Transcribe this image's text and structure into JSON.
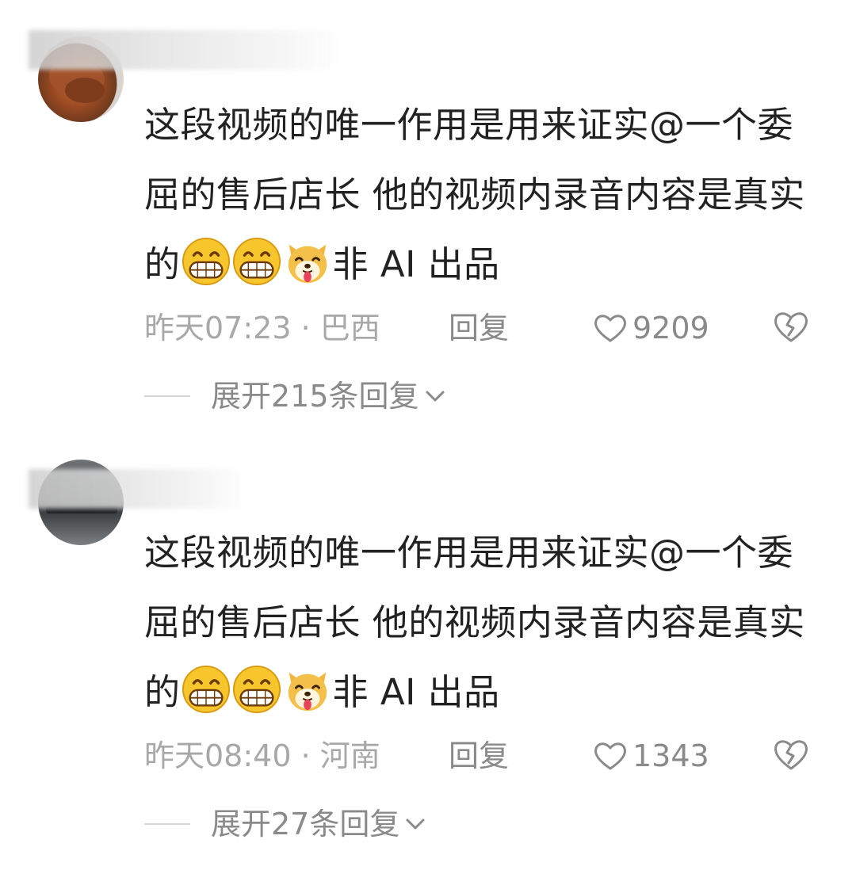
{
  "comments": [
    {
      "text_main": "这段视频的唯一作用是用来证实@一个委屈的售后店长 他的视频内录音内容是真实的",
      "text_tail": "非 AI 出品",
      "emojis": [
        "grin-emoji",
        "grin-emoji",
        "dog-emoji"
      ],
      "time": "昨天07:23",
      "location": "巴西",
      "reply_label": "回复",
      "likes": "9209",
      "expand_label": "展开215条回复"
    },
    {
      "text_main": "这段视频的唯一作用是用来证实@一个委屈的售后店长 他的视频内录音内容是真实的",
      "text_tail": "非 AI 出品",
      "emojis": [
        "grin-emoji",
        "grin-emoji",
        "dog-emoji"
      ],
      "time": "昨天08:40",
      "location": "河南",
      "reply_label": "回复",
      "likes": "1343",
      "expand_label": "展开27条回复"
    }
  ],
  "colors": {
    "text": "#222222",
    "meta": "#a8a8a8",
    "action": "#8a8a8a",
    "emoji_yellow": "#f7c52c"
  }
}
